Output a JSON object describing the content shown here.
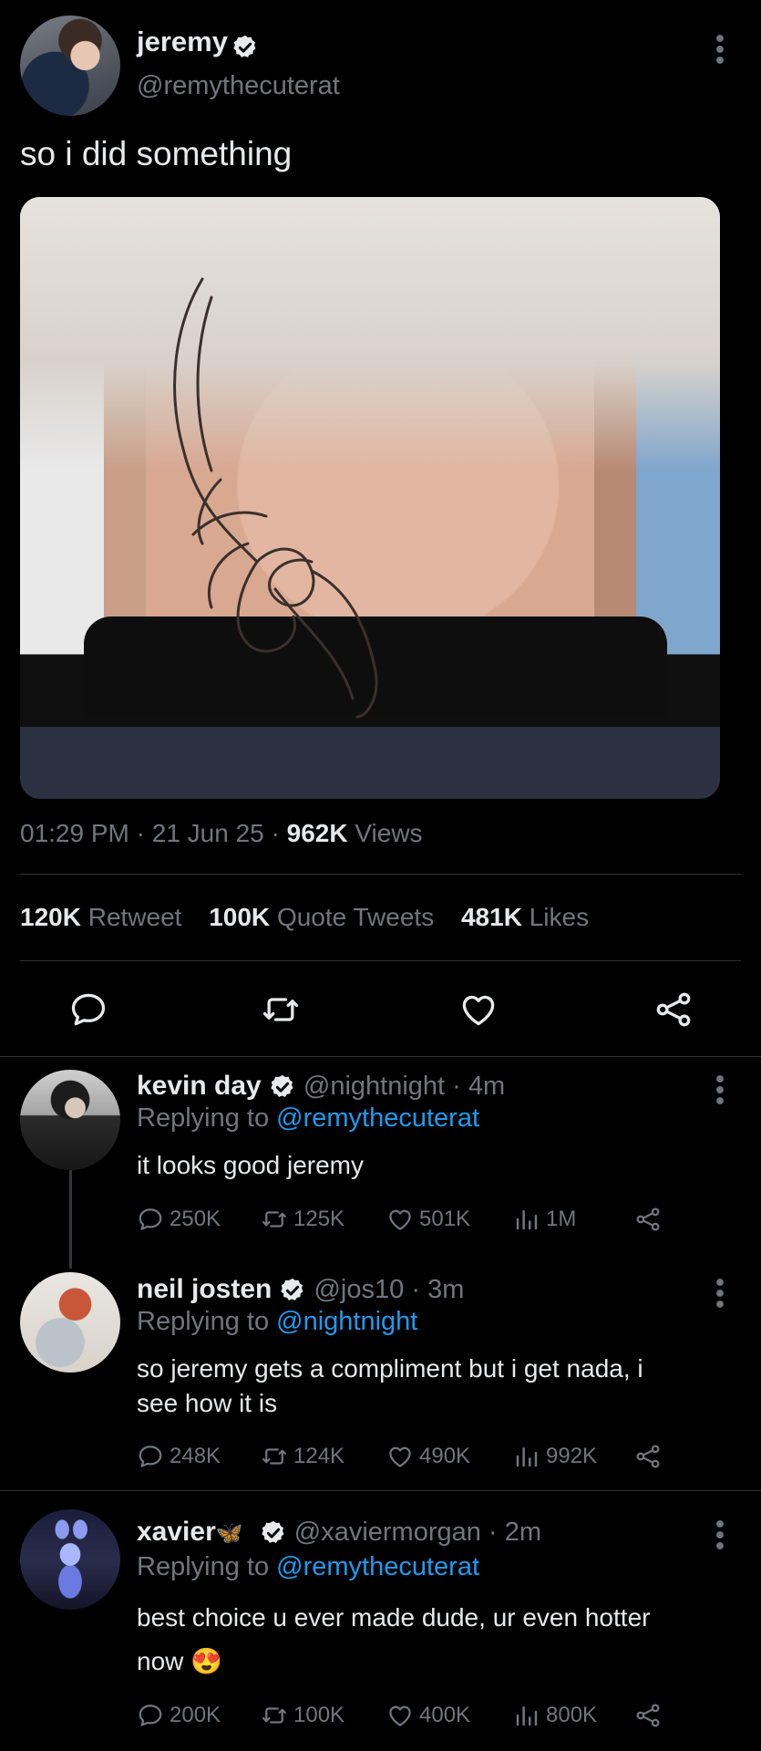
{
  "tweet": {
    "author": {
      "name": "jeremy",
      "handle": "@remythecuterat"
    },
    "text": "so i did something",
    "time": "01:29 PM",
    "date": "21 Jun 25",
    "views_count": "962K",
    "views_label": "Views",
    "retweets_count": "120K",
    "retweets_label": "Retweet",
    "quotes_count": "100K",
    "quotes_label": "Quote Tweets",
    "likes_count": "481K",
    "likes_label": "Likes",
    "separator": "·"
  },
  "replies": [
    {
      "name": "kevin day",
      "handle": "@nightnight",
      "time": "4m",
      "replying_label": "Replying to",
      "replying_to": "@remythecuterat",
      "text": "it looks good jeremy",
      "stats": {
        "replies": "250K",
        "retweets": "125K",
        "likes": "501K",
        "views": "1M"
      }
    },
    {
      "name": "neil josten",
      "handle": "@jos10",
      "time": "3m",
      "replying_label": "Replying to",
      "replying_to": "@nightnight",
      "text_line1": "so jeremy gets a compliment but i get nada, i",
      "text_line2": "see how it is",
      "stats": {
        "replies": "248K",
        "retweets": "124K",
        "likes": "490K",
        "views": "992K"
      }
    },
    {
      "name": "xavier",
      "name_emoji": "🦋",
      "handle": "@xaviermorgan",
      "time": "2m",
      "replying_label": "Replying to",
      "replying_to": "@remythecuterat",
      "text_line1": "best choice u ever made dude, ur even hotter",
      "text_line2": "now",
      "text_emoji": "😍",
      "stats": {
        "replies": "200K",
        "retweets": "100K",
        "likes": "400K",
        "views": "800K"
      }
    }
  ],
  "icons": [
    "verified-badge-icon",
    "more-icon",
    "reply-icon",
    "retweet-icon",
    "like-icon",
    "share-icon",
    "views-icon"
  ],
  "colors": {
    "background": "#000000",
    "text": "#e7e9ea",
    "muted": "#71767b",
    "link": "#1d9bf0",
    "divider": "#2f3336"
  }
}
